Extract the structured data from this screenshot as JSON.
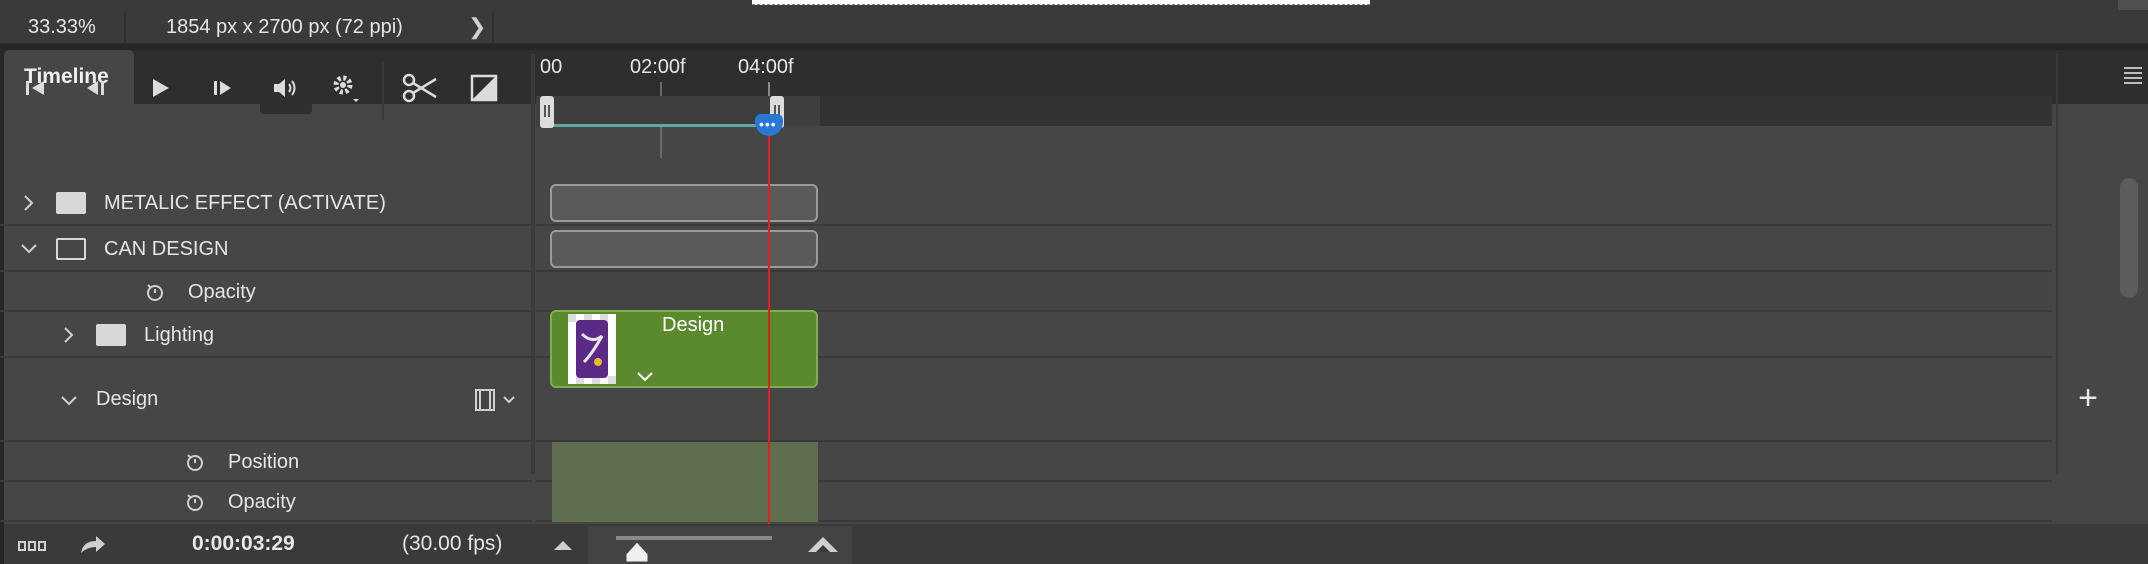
{
  "status_bar": {
    "zoom": "33.33%",
    "doc_info": "1854 px x 2700 px (72 ppi)",
    "arrow": "❯"
  },
  "panel": {
    "tab_title": "Timeline"
  },
  "controls": {
    "buttons": [
      "go-to-first-frame",
      "previous-frame",
      "play",
      "next-frame",
      "mute-audio",
      "settings",
      "split-at-playhead",
      "transition"
    ]
  },
  "ruler": {
    "labels": [
      "00",
      "02:00f",
      "04:00f"
    ]
  },
  "layers": [
    {
      "name": "METALIC EFFECT (ACTIVATE)",
      "type": "group",
      "expanded": false
    },
    {
      "name": "CAN DESIGN",
      "type": "group",
      "expanded": true
    },
    {
      "name": "Opacity",
      "type": "property"
    },
    {
      "name": "Lighting",
      "type": "group",
      "expanded": false
    },
    {
      "name": "Design",
      "type": "video-group",
      "expanded": true
    },
    {
      "name": "Position",
      "type": "property"
    },
    {
      "name": "Opacity",
      "type": "property"
    }
  ],
  "clips": {
    "design_clip_label": "Design"
  },
  "bottom_bar": {
    "current_time": "0:00:03:29",
    "fps": "(30.00 fps)",
    "add_track": "+"
  },
  "colors": {
    "playhead": "#e02020",
    "playhead_head": "#2a78d6",
    "video_clip": "#5b8a2e",
    "work_area": "#5fa7a7"
  }
}
